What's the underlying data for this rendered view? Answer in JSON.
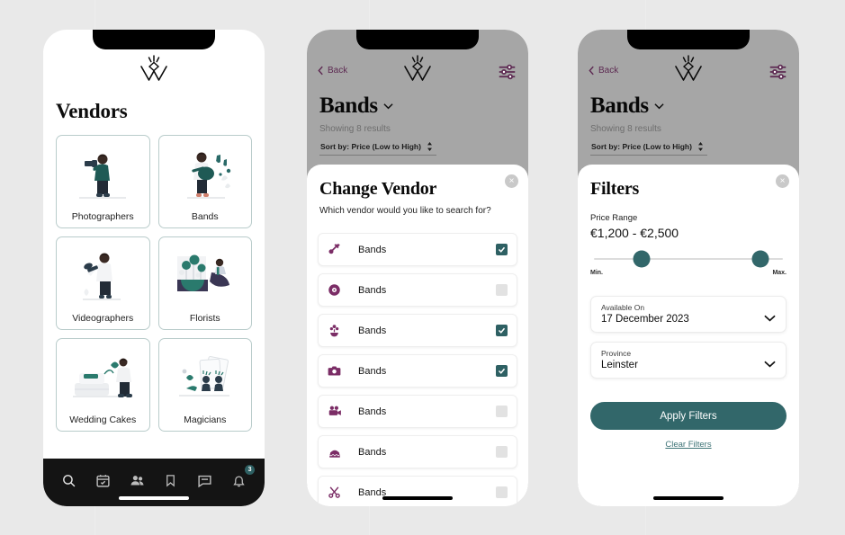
{
  "theme": {
    "background": "#e9e9e9",
    "teal": "#2e6063",
    "teal_light": "#32676a",
    "purple": "#5d2a52",
    "card_border": "#b9cccb",
    "dark": "#141414"
  },
  "screen1": {
    "name": "vendors-list",
    "logo_alt": "wedding-w-logo",
    "title": "Vendors",
    "cards": [
      {
        "label": "Photographers",
        "art": "photographer"
      },
      {
        "label": "Bands",
        "art": "band"
      },
      {
        "label": "Videographers",
        "art": "videographer"
      },
      {
        "label": "Florists",
        "art": "florist"
      },
      {
        "label": "Wedding Cakes",
        "art": "cake"
      },
      {
        "label": "Magicians",
        "art": "magician"
      }
    ],
    "tabbar": [
      {
        "icon": "search-icon",
        "badge": ""
      },
      {
        "icon": "calendar-check-icon",
        "badge": ""
      },
      {
        "icon": "people-icon",
        "badge": ""
      },
      {
        "icon": "bookmark-icon",
        "badge": ""
      },
      {
        "icon": "chat-icon",
        "badge": ""
      },
      {
        "icon": "bell-icon",
        "badge": "3"
      }
    ]
  },
  "screen2": {
    "name": "change-vendor-modal",
    "back_label": "Back",
    "filter_icon": "sliders-icon",
    "results_title": "Bands",
    "results_count": "Showing 8 results",
    "sort_label": "Sort by: Price (Low to High)",
    "sheet": {
      "close_label": "×",
      "title": "Change Vendor",
      "subtitle": "Which vendor would you like to search for?",
      "rows": [
        {
          "icon": "guitar-icon",
          "label": "Bands",
          "checked": true
        },
        {
          "icon": "vinyl-record-icon",
          "label": "Bands",
          "checked": false
        },
        {
          "icon": "flower-icon",
          "label": "Bands",
          "checked": true
        },
        {
          "icon": "camera-icon",
          "label": "Bands",
          "checked": true
        },
        {
          "icon": "video-camera-icon",
          "label": "Bands",
          "checked": false
        },
        {
          "icon": "cake-icon",
          "label": "Bands",
          "checked": false
        },
        {
          "icon": "scissors-icon",
          "label": "Bands",
          "checked": false
        }
      ]
    }
  },
  "screen3": {
    "name": "filters-modal",
    "back_label": "Back",
    "filter_icon": "sliders-icon",
    "results_title": "Bands",
    "results_count": "Showing 8 results",
    "sort_label": "Sort by: Price (Low to High)",
    "sheet": {
      "close_label": "×",
      "title": "Filters",
      "price_label": "Price Range",
      "price_value": "€1,200 - €2,500",
      "slider": {
        "min_label": "Min.",
        "max_label": "Max.",
        "min_pct": 25,
        "max_pct": 88
      },
      "fields": [
        {
          "caption": "Available On",
          "value": "17 December 2023"
        },
        {
          "caption": "Province",
          "value": "Leinster"
        }
      ],
      "apply_label": "Apply Filters",
      "clear_label": "Clear Filters"
    }
  }
}
